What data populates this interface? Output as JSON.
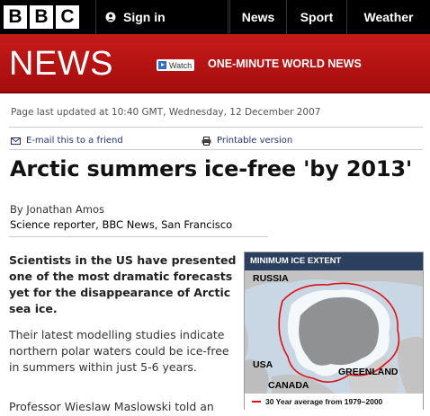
{
  "header": {
    "logo_letters": [
      "B",
      "B",
      "C"
    ],
    "signin_label": "Sign in",
    "nav": [
      "News",
      "Sport",
      "Weather"
    ]
  },
  "banner": {
    "title": "NEWS",
    "watch_label": "Watch",
    "promo": "ONE-MINUTE WORLD NEWS"
  },
  "article": {
    "updated": "Page last updated at 10:40 GMT, Wednesday, 12 December 2007",
    "email_link": "E-mail this to a friend",
    "print_link": "Printable version",
    "headline": "Arctic summers ice-free 'by 2013'",
    "byline": "By Jonathan Amos",
    "role": "Science reporter, BBC News, San Francisco",
    "lead": "Scientists in the US have presented one of the most dramatic forecasts yet for the disappearance of Arctic sea ice.",
    "para1": "Their latest modelling studies indicate northern polar waters could be ice-free in summers within just 5-6 years.",
    "para2": "Professor Wieslaw Maslowski told an"
  },
  "map": {
    "title": "MINIMUM ICE EXTENT",
    "labels": {
      "russia": "RUSSIA",
      "usa": "USA",
      "canada": "CANADA",
      "greenland": "GREENLAND"
    },
    "legend": "30 Year average from 1979–2000",
    "line_color": "#dd1111"
  }
}
